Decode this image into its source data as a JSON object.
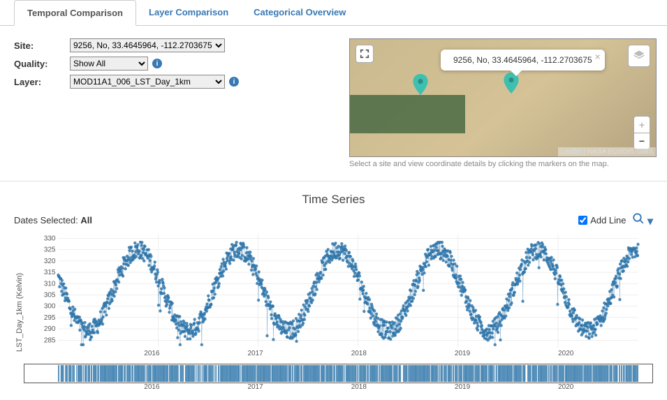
{
  "tabs": {
    "temporal": "Temporal Comparison",
    "layer": "Layer Comparison",
    "categorical": "Categorical Overview"
  },
  "form": {
    "site_label": "Site:",
    "site_value": "9256, No, 33.4645964, -112.2703675",
    "quality_label": "Quality:",
    "quality_value": "Show All",
    "layer_label": "Layer:",
    "layer_value": "MOD11A1_006_LST_Day_1km"
  },
  "map": {
    "popup_text": "9256, No, 33.4645964, -112.2703675",
    "attrib_leaflet": "Leaflet",
    "attrib_rest": " | NASA EOSDIS GIBS",
    "hint": "Select a site and view coordinate details by clicking the markers on the map."
  },
  "timeseries": {
    "title": "Time Series",
    "dates_label": "Dates Selected: ",
    "dates_value": "All",
    "add_line": "Add Line"
  },
  "chart_data": {
    "type": "scatter",
    "title": "Time Series",
    "ylabel": "LST_Day_1km (Kelvin)",
    "xlabel": "",
    "x_range": [
      2015,
      2020.8
    ],
    "ylim": [
      282,
      332
    ],
    "y_ticks": [
      285,
      290,
      295,
      300,
      305,
      310,
      315,
      320,
      325,
      330
    ],
    "x_ticks": [
      2016,
      2017,
      2018,
      2019,
      2020
    ],
    "series": [
      {
        "name": "LST_Day_1km",
        "color": "#2f76aa",
        "pattern": "seasonal",
        "period_years": 1.0,
        "mean": 307,
        "amplitude": 18,
        "noise": 4,
        "min": 283,
        "max": 332,
        "n_points": 1400
      }
    ],
    "overview": {
      "x_range": [
        2015,
        2020.8
      ],
      "x_ticks": [
        2016,
        2017,
        2018,
        2019,
        2020
      ]
    }
  }
}
